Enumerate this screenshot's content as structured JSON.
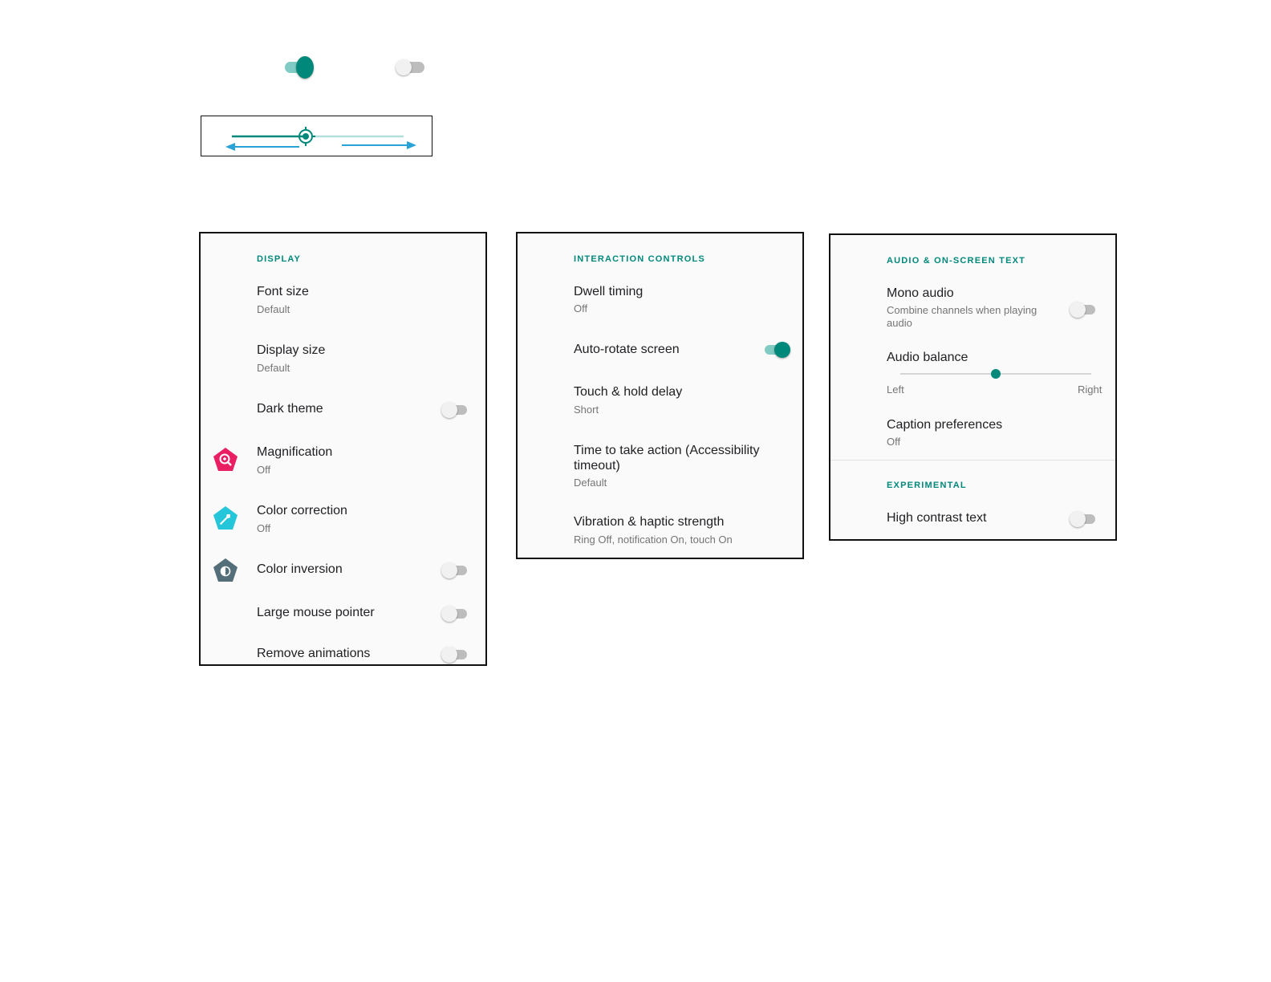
{
  "colors": {
    "accent": "#00897b",
    "accent_light": "#80cbc4",
    "arrow_blue": "#29a3d6",
    "magnification_icon": "#e91e63",
    "color_correction_icon": "#26c6da",
    "color_inversion_icon": "#546e7a"
  },
  "legend": {
    "toggle_on": {
      "icon": "toggle-on",
      "state": true
    },
    "toggle_off": {
      "icon": "toggle-off",
      "state": false
    },
    "brightness_slider": {
      "icon": "brightness-slider",
      "value_fraction": 0.43
    }
  },
  "display_panel": {
    "section_label": "DISPLAY",
    "font_size": {
      "title": "Font size",
      "value": "Default"
    },
    "display_size": {
      "title": "Display size",
      "value": "Default"
    },
    "dark_theme": {
      "title": "Dark theme",
      "enabled": false
    },
    "magnification": {
      "title": "Magnification",
      "value": "Off",
      "icon": "magnification-icon"
    },
    "color_correction": {
      "title": "Color correction",
      "value": "Off",
      "icon": "color-correction-icon"
    },
    "color_inversion": {
      "title": "Color inversion",
      "enabled": false,
      "icon": "color-inversion-icon"
    },
    "large_mouse_pointer": {
      "title": "Large mouse pointer",
      "enabled": false
    },
    "remove_animations": {
      "title": "Remove animations",
      "enabled": false
    }
  },
  "interaction_panel": {
    "section_label": "INTERACTION CONTROLS",
    "dwell_timing": {
      "title": "Dwell timing",
      "value": "Off"
    },
    "auto_rotate": {
      "title": "Auto-rotate screen",
      "enabled": true
    },
    "touch_hold_delay": {
      "title": "Touch & hold delay",
      "value": "Short"
    },
    "time_to_take_action": {
      "title": "Time to take action (Accessibility timeout)",
      "value": "Default"
    },
    "vibration": {
      "title": "Vibration & haptic strength",
      "value": "Ring Off, notification On, touch On"
    }
  },
  "audio_panel": {
    "section_label": "AUDIO & ON-SCREEN TEXT",
    "mono_audio": {
      "title": "Mono audio",
      "summary": "Combine channels when playing audio",
      "enabled": false
    },
    "audio_balance": {
      "title": "Audio balance",
      "left_label": "Left",
      "right_label": "Right",
      "value_fraction": 0.5
    },
    "caption_preferences": {
      "title": "Caption preferences",
      "value": "Off"
    },
    "experimental_label": "EXPERIMENTAL",
    "high_contrast_text": {
      "title": "High contrast text",
      "enabled": false
    }
  }
}
